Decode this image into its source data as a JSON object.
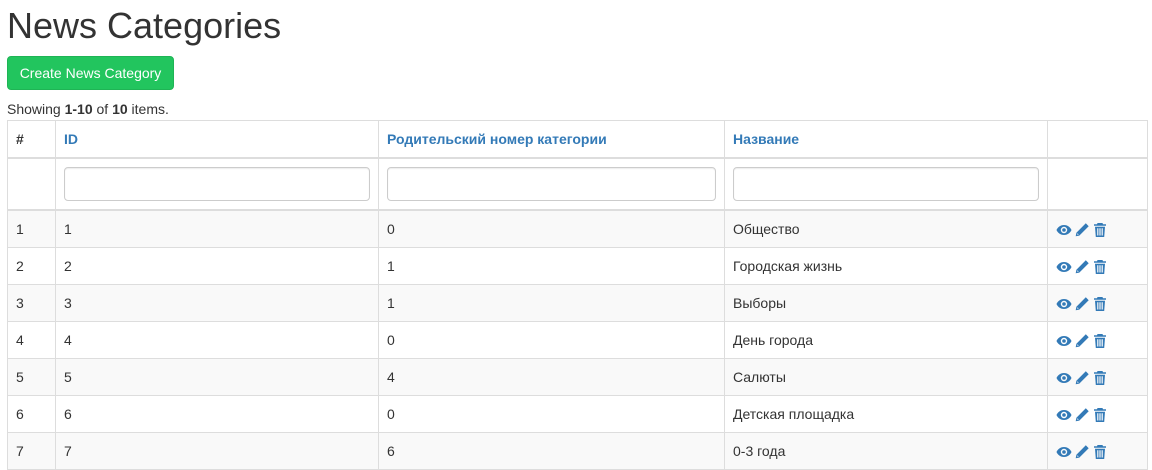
{
  "page": {
    "title": "News Categories",
    "create_button": "Create News Category"
  },
  "summary": {
    "prefix": "Showing ",
    "range": "1-10",
    "middle": " of ",
    "total": "10",
    "suffix": " items."
  },
  "table": {
    "headers": {
      "num": "#",
      "id": "ID",
      "parent": "Родительский номер категории",
      "name": "Название"
    },
    "rows": [
      {
        "num": "1",
        "id": "1",
        "parent": "0",
        "name": "Общество"
      },
      {
        "num": "2",
        "id": "2",
        "parent": "1",
        "name": "Городская жизнь"
      },
      {
        "num": "3",
        "id": "3",
        "parent": "1",
        "name": "Выборы"
      },
      {
        "num": "4",
        "id": "4",
        "parent": "0",
        "name": "День города"
      },
      {
        "num": "5",
        "id": "5",
        "parent": "4",
        "name": "Салюты"
      },
      {
        "num": "6",
        "id": "6",
        "parent": "0",
        "name": "Детская площадка"
      },
      {
        "num": "7",
        "id": "7",
        "parent": "6",
        "name": "0-3 года"
      }
    ],
    "action_icons": [
      "eye-icon",
      "pencil-icon",
      "trash-icon"
    ]
  },
  "colors": {
    "primary_button": "#22c55e",
    "link": "#337ab7",
    "stripe": "#f9f9f9",
    "border": "#dddddd"
  }
}
